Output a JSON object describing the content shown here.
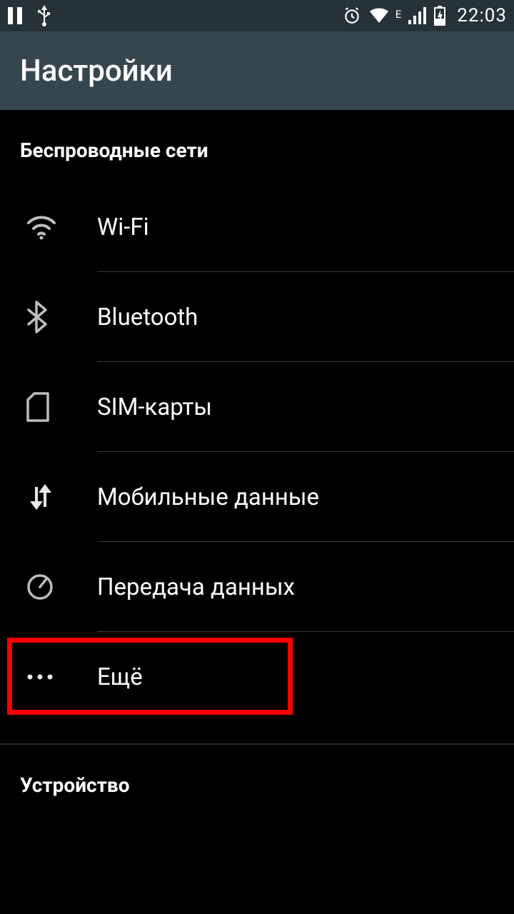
{
  "status": {
    "time": "22:03",
    "network_type": "E"
  },
  "appbar": {
    "title": "Настройки"
  },
  "sections": {
    "wireless": {
      "header": "Беспроводные сети",
      "items": {
        "wifi": "Wi-Fi",
        "bluetooth": "Bluetooth",
        "sim": "SIM-карты",
        "mobile_data": "Мобильные данные",
        "data_usage": "Передача данных",
        "more": "Ещё"
      }
    },
    "device": {
      "header": "Устройство"
    }
  }
}
